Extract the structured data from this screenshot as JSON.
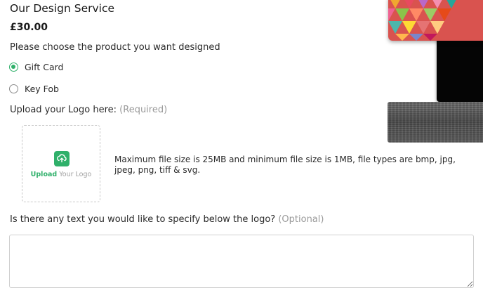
{
  "product": {
    "title": "Our Design Service",
    "price": "£30.00"
  },
  "product_choice": {
    "prompt": "Please choose the product you want designed",
    "options": [
      {
        "label": "Gift Card",
        "selected": true
      },
      {
        "label": "Key Fob",
        "selected": false
      }
    ]
  },
  "logo_upload": {
    "heading": "Upload your Logo here:",
    "requirement": "(Required)",
    "dropzone_strong": "Upload",
    "dropzone_soft": "Your Logo",
    "info": "Maximum file size is 25MB and minimum file size is 1MB, file types are bmp, jpg, jpeg, png, tiff & svg."
  },
  "logo_text": {
    "question": "Is there any text you would like to specify below the logo?",
    "note": "(Optional)",
    "value": ""
  },
  "colors": {
    "accent": "#2fb06a",
    "muted_text": "#9a9a9a",
    "border": "#cfcfcf"
  },
  "icons": {
    "upload": "upload-cloud-icon"
  }
}
